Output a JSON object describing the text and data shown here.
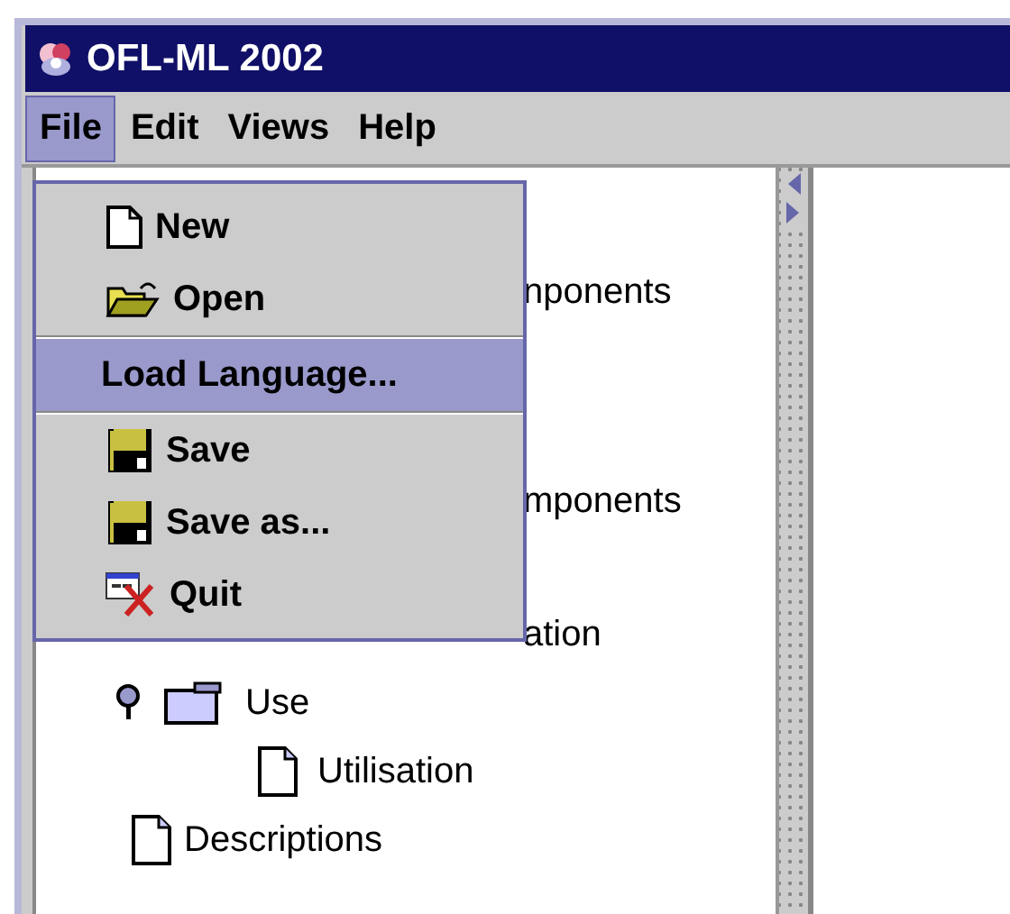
{
  "window": {
    "title": "OFL-ML 2002"
  },
  "menubar": [
    {
      "label": "File",
      "selected": true
    },
    {
      "label": "Edit",
      "selected": false
    },
    {
      "label": "Views",
      "selected": false
    },
    {
      "label": "Help",
      "selected": false
    }
  ],
  "file_menu": [
    {
      "label": "New",
      "kind": "new",
      "selected": false
    },
    {
      "label": "Open",
      "kind": "open",
      "selected": false
    },
    {
      "label": "Load Language...",
      "kind": "plain",
      "selected": true
    },
    {
      "label": "Save",
      "kind": "save",
      "selected": false
    },
    {
      "label": "Save as...",
      "kind": "save",
      "selected": false
    },
    {
      "label": "Quit",
      "kind": "quit",
      "selected": false
    }
  ],
  "tree": {
    "partly_hidden_rows": [
      "nponents",
      "mponents",
      "ation"
    ],
    "items": [
      {
        "label": "Use",
        "kind": "folder",
        "expanded": true,
        "children": [
          {
            "label": "Utilisation",
            "kind": "document"
          }
        ]
      },
      {
        "label": "Descriptions",
        "kind": "document"
      }
    ]
  }
}
